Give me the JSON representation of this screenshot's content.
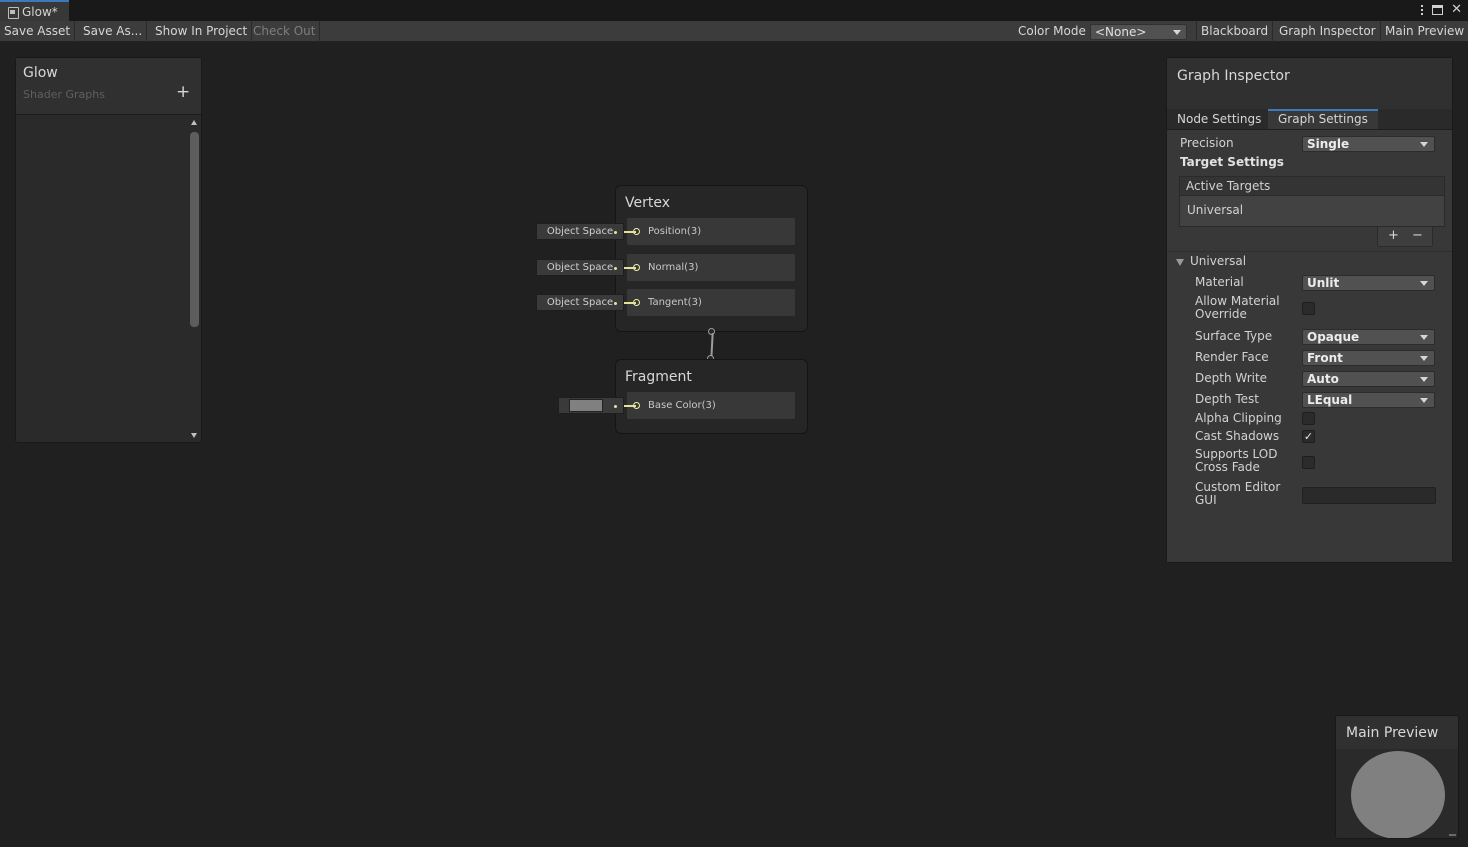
{
  "window": {
    "tab_title": "Glow*",
    "tab_icon": "shader-graph-icon",
    "controls": [
      "kebab-menu-icon",
      "maximize-icon",
      "close-icon"
    ],
    "close_glyph": "✕"
  },
  "toolbar": {
    "save_asset": "Save Asset",
    "save_as": "Save As...",
    "show_in_project": "Show In Project",
    "check_out": "Check Out",
    "color_mode_label": "Color Mode",
    "color_mode_value": "<None>",
    "blackboard": "Blackboard",
    "graph_inspector": "Graph Inspector",
    "main_preview": "Main Preview"
  },
  "blackboard": {
    "title": "Glow",
    "subtitle": "Shader Graphs",
    "add_glyph": "+"
  },
  "vertex": {
    "title": "Vertex",
    "slots": [
      {
        "space": "Object Space",
        "label": "Position(3)"
      },
      {
        "space": "Object Space",
        "label": "Normal(3)"
      },
      {
        "space": "Object Space",
        "label": "Tangent(3)"
      }
    ]
  },
  "fragment": {
    "title": "Fragment",
    "slots": [
      {
        "label": "Base Color(3)",
        "color": "#808080"
      }
    ]
  },
  "inspector": {
    "title": "Graph Inspector",
    "tabs": [
      "Node Settings",
      "Graph Settings"
    ],
    "active_tab": "Graph Settings",
    "precision_label": "Precision",
    "precision_value": "Single",
    "target_settings": "Target Settings",
    "active_targets_header": "Active Targets",
    "active_targets": [
      "Universal"
    ],
    "add_glyph": "+",
    "remove_glyph": "−",
    "universal_foldout": "Universal",
    "material_label": "Material",
    "material_value": "Unlit",
    "allow_override_label": "Allow Material Override",
    "allow_override_checked": false,
    "surface_type_label": "Surface Type",
    "surface_type_value": "Opaque",
    "render_face_label": "Render Face",
    "render_face_value": "Front",
    "depth_write_label": "Depth Write",
    "depth_write_value": "Auto",
    "depth_test_label": "Depth Test",
    "depth_test_value": "LEqual",
    "alpha_clipping_label": "Alpha Clipping",
    "alpha_clipping_checked": false,
    "cast_shadows_label": "Cast Shadows",
    "cast_shadows_checked": true,
    "check_glyph": "✓",
    "lod_crossfade_label": "Supports LOD Cross Fade",
    "lod_crossfade_checked": false,
    "custom_editor_label": "Custom Editor GUI",
    "custom_editor_value": ""
  },
  "preview": {
    "title": "Main Preview",
    "sphere_color": "#808080"
  },
  "colors": {
    "accent": "#3a79bb",
    "wire": "#e3e39a",
    "background": "#202020"
  }
}
